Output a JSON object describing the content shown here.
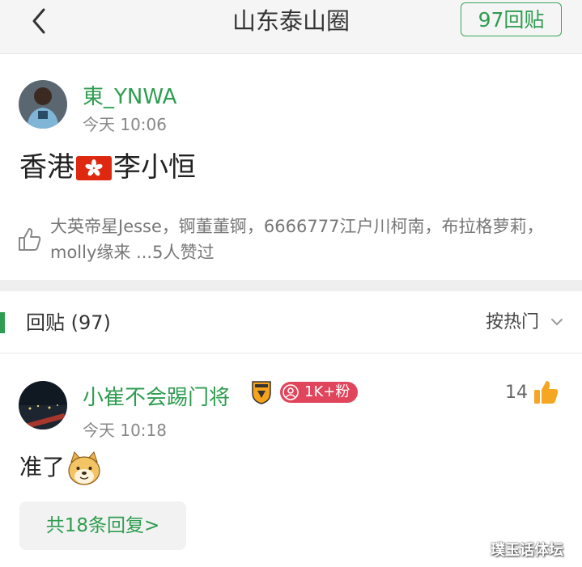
{
  "header": {
    "back_icon": "chevron-left-icon",
    "title": "山东泰山圈",
    "reply_count_label": "97回贴"
  },
  "post": {
    "author": "東_YNWA",
    "time": "今天 10:06",
    "text_before": "香港",
    "text_after": "李小恒",
    "flag_icon": "hong-kong-flag-icon",
    "likes_icon": "thumbs-up-outline-icon",
    "likes_text": "大英帝星Jesse，锕董董锕，6666777江户川柯南，布拉格萝莉，molly缘来 ...5人赞过"
  },
  "replies_header": {
    "label": "回贴 (97)",
    "sort_label": "按热门",
    "sort_icon": "chevron-down-icon"
  },
  "reply": {
    "author": "小崔不会踢门将",
    "fans_badge": "1K+粉",
    "time": "今天 10:18",
    "text": "准了",
    "emoji": "doge-emoji-icon",
    "like_count": "14",
    "sub_replies": "共18条回复>"
  },
  "watermark": "璞玉话体坛",
  "colors": {
    "accent": "#2e9d50",
    "badge": "#e0455b",
    "like_orange": "#f5a623"
  }
}
